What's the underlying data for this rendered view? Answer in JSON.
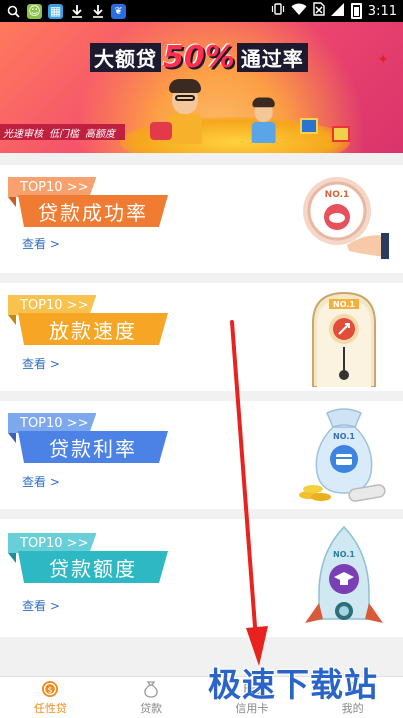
{
  "status_bar": {
    "time": "3:11",
    "icons": [
      "search-icon",
      "app-icon",
      "gallery-icon",
      "download-icon",
      "download-icon",
      "baidu-icon",
      "vibrate-icon",
      "wifi-icon",
      "no-sim-icon",
      "signal-icon",
      "battery-icon"
    ]
  },
  "banner": {
    "title_a": "大额贷",
    "title_b": "50%",
    "title_c": "通过率",
    "tags": [
      "光速审核",
      "低门槛",
      "高额度"
    ],
    "page_count": 3,
    "active_page": 1
  },
  "cards": [
    {
      "tag": "TOP10 >>",
      "title": "贷款成功率",
      "link": "查看 >",
      "illustration": "piggy-bank-clock-icon"
    },
    {
      "tag": "TOP10 >>",
      "title": "放款速度",
      "link": "查看 >",
      "illustration": "rocket-clock-icon"
    },
    {
      "tag": "TOP10 >>",
      "title": "贷款利率",
      "link": "查看 >",
      "illustration": "money-bag-card-icon"
    },
    {
      "tag": "TOP10 >>",
      "title": "贷款额度",
      "link": "查看 >",
      "illustration": "rocket-graduation-icon"
    }
  ],
  "bottom_nav": [
    {
      "label": "任性贷",
      "icon": "coin-icon",
      "active": true
    },
    {
      "label": "贷款",
      "icon": "money-bag-icon",
      "active": false
    },
    {
      "label": "信用卡",
      "icon": "credit-card-icon",
      "active": false
    },
    {
      "label": "我的",
      "icon": "user-icon",
      "active": false
    }
  ],
  "watermark": "极速下载站",
  "colors": {
    "accent": "#f08a1c",
    "link": "#2e6fc2",
    "arrow": "#e8231f",
    "watermark": "#2a64c8"
  }
}
